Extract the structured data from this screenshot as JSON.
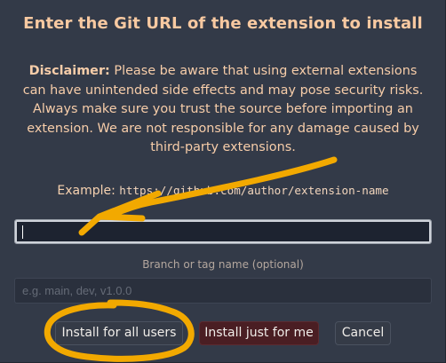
{
  "dialog": {
    "title": "Enter the Git URL of the extension to install",
    "disclaimer_label": "Disclaimer:",
    "disclaimer_text": " Please be aware that using external extensions can have unintended side effects and may pose security risks. Always make sure you trust the source before importing an extension. We are not responsible for any damage caused by third-party extensions.",
    "example_label": "Example: ",
    "example_url": "https://github.com/author/extension-name",
    "url_input": {
      "value": "",
      "placeholder": ""
    },
    "branch_label": "Branch or tag name (optional)",
    "branch_input": {
      "value": "",
      "placeholder": "e.g. main, dev, v1.0.0"
    },
    "buttons": {
      "install_all": "Install for all users",
      "install_me": "Install just for me",
      "cancel": "Cancel"
    }
  },
  "colors": {
    "dialog_bg": "#333a48",
    "title": "#f8c9a1",
    "install_me_bg": "#4a1e23",
    "annotation": "#f2a900"
  }
}
